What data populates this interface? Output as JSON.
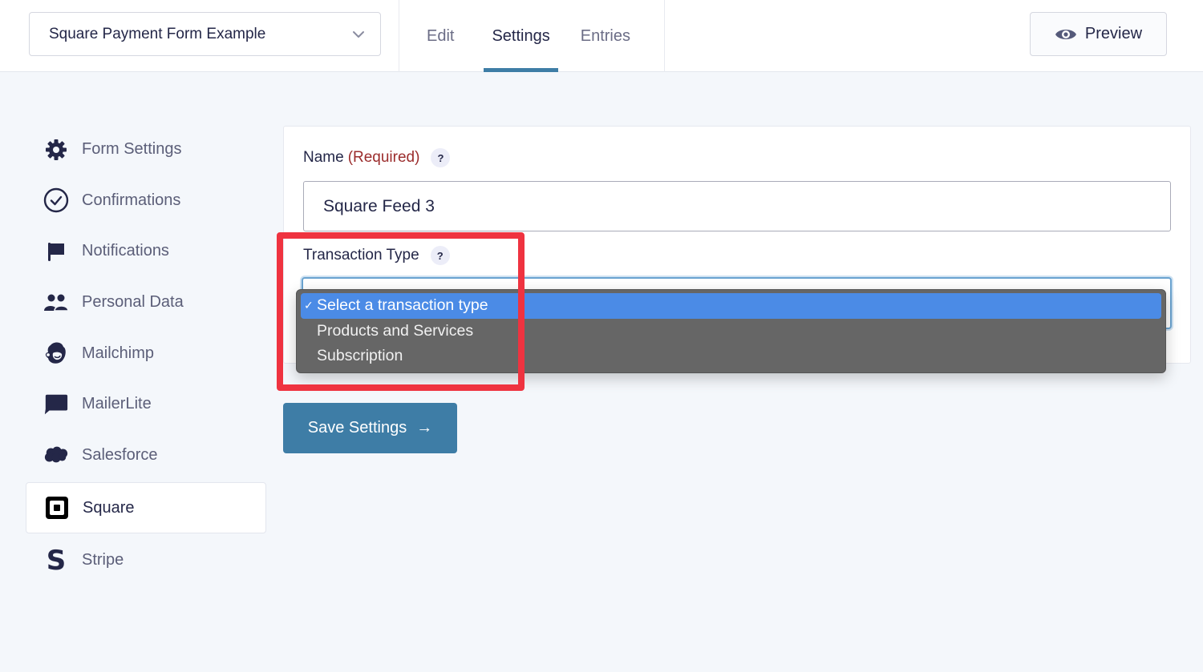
{
  "topbar": {
    "form_selector": {
      "value": "Square Payment Form Example",
      "icon": "chevron-down-icon"
    },
    "tabs": [
      {
        "label": "Edit",
        "active": false
      },
      {
        "label": "Settings",
        "active": true
      },
      {
        "label": "Entries",
        "active": false
      }
    ],
    "preview_button": {
      "label": "Preview",
      "icon": "eye-icon"
    }
  },
  "sidebar": {
    "items": [
      {
        "label": "Form Settings",
        "icon": "gear-icon",
        "active": false
      },
      {
        "label": "Confirmations",
        "icon": "check-circle-icon",
        "active": false
      },
      {
        "label": "Notifications",
        "icon": "flag-icon",
        "active": false
      },
      {
        "label": "Personal Data",
        "icon": "users-icon",
        "active": false
      },
      {
        "label": "Mailchimp",
        "icon": "mailchimp-icon",
        "active": false
      },
      {
        "label": "MailerLite",
        "icon": "chat-bubble-icon",
        "active": false
      },
      {
        "label": "Salesforce",
        "icon": "salesforce-cloud-icon",
        "active": false
      },
      {
        "label": "Square",
        "icon": "square-logo-icon",
        "active": true
      },
      {
        "label": "Stripe",
        "icon": "stripe-s-icon",
        "active": false
      }
    ]
  },
  "form": {
    "name_field": {
      "label": "Name",
      "required_text": "(Required)",
      "help": "?",
      "value": "Square Feed 3"
    },
    "transaction_type": {
      "label": "Transaction Type",
      "help": "?",
      "selected": "Select a transaction type",
      "check": "✓",
      "options": [
        "Select a transaction type",
        "Products and Services",
        "Subscription"
      ]
    },
    "save_button": {
      "label": "Save Settings",
      "arrow": "→"
    }
  },
  "colors": {
    "accent": "#3e7da6",
    "required": "#9b2c2c",
    "highlight_annotation": "#ef3340",
    "dropdown_selected": "#4b8be6",
    "dropdown_bg": "#666666",
    "page_bg": "#f4f7fb"
  }
}
